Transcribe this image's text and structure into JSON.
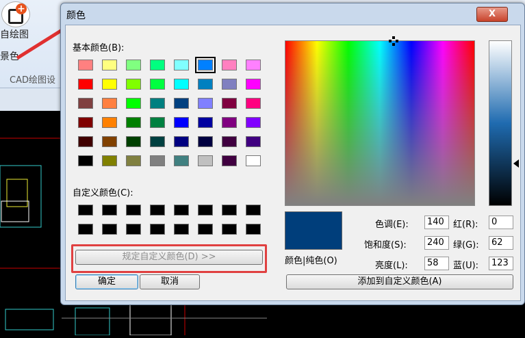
{
  "background_app": {
    "ribbon_item_1": "自绘图",
    "ribbon_item_2": "景色",
    "group_label": "CAD绘图设"
  },
  "dialog": {
    "title": "颜色",
    "close_label": "X",
    "basic_colors_label": "基本颜色(B):",
    "custom_colors_label": "自定义颜色(C):",
    "define_custom_button": "规定自定义颜色(D) >>",
    "ok_button": "确定",
    "cancel_button": "取消",
    "color_solid_label": "颜色|纯色(O)",
    "add_custom_button": "添加到自定义颜色(A)",
    "fields": {
      "hue": {
        "label": "色调(E):",
        "value": "140"
      },
      "sat": {
        "label": "饱和度(S):",
        "value": "240"
      },
      "lum": {
        "label": "亮度(L):",
        "value": "58"
      },
      "red": {
        "label": "红(R):",
        "value": "0"
      },
      "green": {
        "label": "绿(G):",
        "value": "62"
      },
      "blue": {
        "label": "蓝(U):",
        "value": "123"
      }
    },
    "selected_color": "#003e7b",
    "basic_colors": [
      [
        "#ff8080",
        "#ffff80",
        "#80ff80",
        "#00ff80",
        "#80ffff",
        "#0080ff",
        "#ff80c0",
        "#ff80ff"
      ],
      [
        "#ff0000",
        "#ffff00",
        "#80ff00",
        "#00ff40",
        "#00ffff",
        "#0080c0",
        "#8080c0",
        "#ff00ff"
      ],
      [
        "#804040",
        "#ff8040",
        "#00ff00",
        "#008080",
        "#004080",
        "#8080ff",
        "#800040",
        "#ff0080"
      ],
      [
        "#800000",
        "#ff8000",
        "#008000",
        "#008040",
        "#0000ff",
        "#0000a0",
        "#800080",
        "#8000ff"
      ],
      [
        "#400000",
        "#804000",
        "#004000",
        "#004040",
        "#000080",
        "#000040",
        "#400040",
        "#400080"
      ],
      [
        "#000000",
        "#808000",
        "#808040",
        "#808080",
        "#408080",
        "#c0c0c0",
        "#400040",
        "#ffffff"
      ]
    ],
    "selected_swatch": [
      0,
      5
    ]
  }
}
